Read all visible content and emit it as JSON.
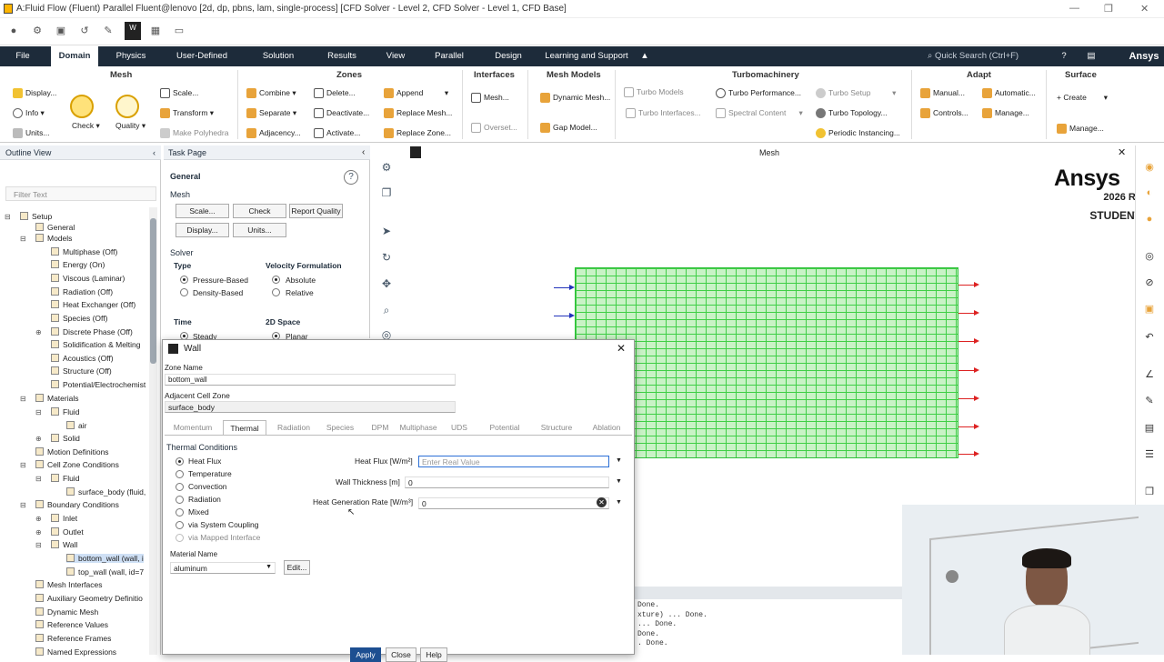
{
  "window": {
    "title": "A:Fluid Flow (Fluent) Parallel Fluent@lenovo  [2d, dp, pbns, lam, single-process] [CFD Solver - Level 2, CFD Solver - Level 1, CFD Base]",
    "min": "—",
    "max": "❐",
    "close": "✕"
  },
  "menu": {
    "file": "File",
    "domain": "Domain",
    "physics": "Physics",
    "user_defined": "User-Defined",
    "solution": "Solution",
    "results": "Results",
    "view": "View",
    "parallel": "Parallel",
    "design": "Design",
    "learning": "Learning and Support",
    "search_placeholder": "Quick Search (Ctrl+F)",
    "brand": "Ansys"
  },
  "ribbon": {
    "mesh": {
      "title": "Mesh",
      "display": "Display...",
      "info": "Info",
      "units": "Units...",
      "check": "Check",
      "quality": "Quality",
      "scale": "Scale...",
      "transform": "Transform",
      "make_polyhedra": "Make Polyhedra"
    },
    "zones": {
      "title": "Zones",
      "combine": "Combine",
      "separate": "Separate",
      "adjacency": "Adjacency...",
      "delete": "Delete...",
      "deactivate": "Deactivate...",
      "activate": "Activate...",
      "append": "Append",
      "replace_mesh": "Replace Mesh...",
      "replace_zone": "Replace Zone..."
    },
    "interfaces": {
      "title": "Interfaces",
      "mesh": "Mesh...",
      "overset": "Overset..."
    },
    "mesh_models": {
      "title": "Mesh Models",
      "dynamic_mesh": "Dynamic Mesh...",
      "gap_model": "Gap Model..."
    },
    "turbomachinery": {
      "title": "Turbomachinery",
      "turbo_models": "Turbo Models",
      "turbo_interfaces": "Turbo Interfaces...",
      "turbo_performance": "Turbo Performance...",
      "spectral_content": "Spectral Content",
      "turbo_setup": "Turbo Setup",
      "turbo_topology": "Turbo Topology...",
      "periodic_instancing": "Periodic Instancing..."
    },
    "adapt": {
      "title": "Adapt",
      "manual": "Manual...",
      "automatic": "Automatic...",
      "controls": "Controls...",
      "manage": "Manage..."
    },
    "surface": {
      "title": "Surface",
      "create": "Create",
      "manage": "Manage..."
    }
  },
  "outline": {
    "title": "Outline View",
    "filter_placeholder": "Filter Text",
    "items": [
      "Setup",
      "General",
      "Models",
      "Multiphase (Off)",
      "Energy (On)",
      "Viscous (Laminar)",
      "Radiation (Off)",
      "Heat Exchanger (Off)",
      "Species (Off)",
      "Discrete Phase (Off)",
      "Solidification & Melting",
      "Acoustics (Off)",
      "Structure (Off)",
      "Potential/Electrochemist",
      "Materials",
      "Fluid",
      "air",
      "Solid",
      "Motion Definitions",
      "Cell Zone Conditions",
      "Fluid",
      "surface_body (fluid,",
      "Boundary Conditions",
      "Inlet",
      "Outlet",
      "Wall",
      "bottom_wall (wall, i",
      "top_wall (wall, id=7",
      "Mesh Interfaces",
      "Auxiliary Geometry Definitio",
      "Dynamic Mesh",
      "Reference Values",
      "Reference Frames",
      "Named Expressions"
    ]
  },
  "taskpage": {
    "title": "Task Page",
    "general": "General",
    "mesh": "Mesh",
    "scale": "Scale...",
    "check": "Check",
    "report_quality": "Report Quality",
    "display": "Display...",
    "units": "Units...",
    "solver": "Solver",
    "type": "Type",
    "pressure_based": "Pressure-Based",
    "density_based": "Density-Based",
    "velocity_formulation": "Velocity Formulation",
    "absolute": "Absolute",
    "relative": "Relative",
    "time": "Time",
    "steady": "Steady",
    "space": "2D Space",
    "planar": "Planar"
  },
  "graphics": {
    "title": "Mesh",
    "ansys": "Ansys",
    "version": "2026 R1",
    "student": "STUDENT"
  },
  "console": {
    "lines": [
      "Done.",
      "xture) ... Done.",
      "... Done.",
      "Done.",
      ". Done."
    ]
  },
  "dialog": {
    "title": "Wall",
    "zone_name_label": "Zone Name",
    "zone_name": "bottom_wall",
    "adjacent_label": "Adjacent Cell Zone",
    "adjacent": "surface_body",
    "tabs": [
      "Momentum",
      "Thermal",
      "Radiation",
      "Species",
      "DPM",
      "Multiphase",
      "UDS",
      "Potential",
      "Structure",
      "Ablation"
    ],
    "thermal_conditions": "Thermal Conditions",
    "options": [
      "Heat Flux",
      "Temperature",
      "Convection",
      "Radiation",
      "Mixed",
      "via System Coupling",
      "via Mapped Interface"
    ],
    "heat_flux_label": "Heat Flux [W/m²]",
    "heat_flux_placeholder": "Enter Real Value",
    "wall_thickness_label": "Wall Thickness [m]",
    "wall_thickness": "0",
    "heat_gen_label": "Heat Generation Rate [W/m³]",
    "heat_gen": "0",
    "material_label": "Material Name",
    "material": "aluminum",
    "edit": "Edit...",
    "apply": "Apply",
    "close": "Close",
    "help": "Help"
  }
}
